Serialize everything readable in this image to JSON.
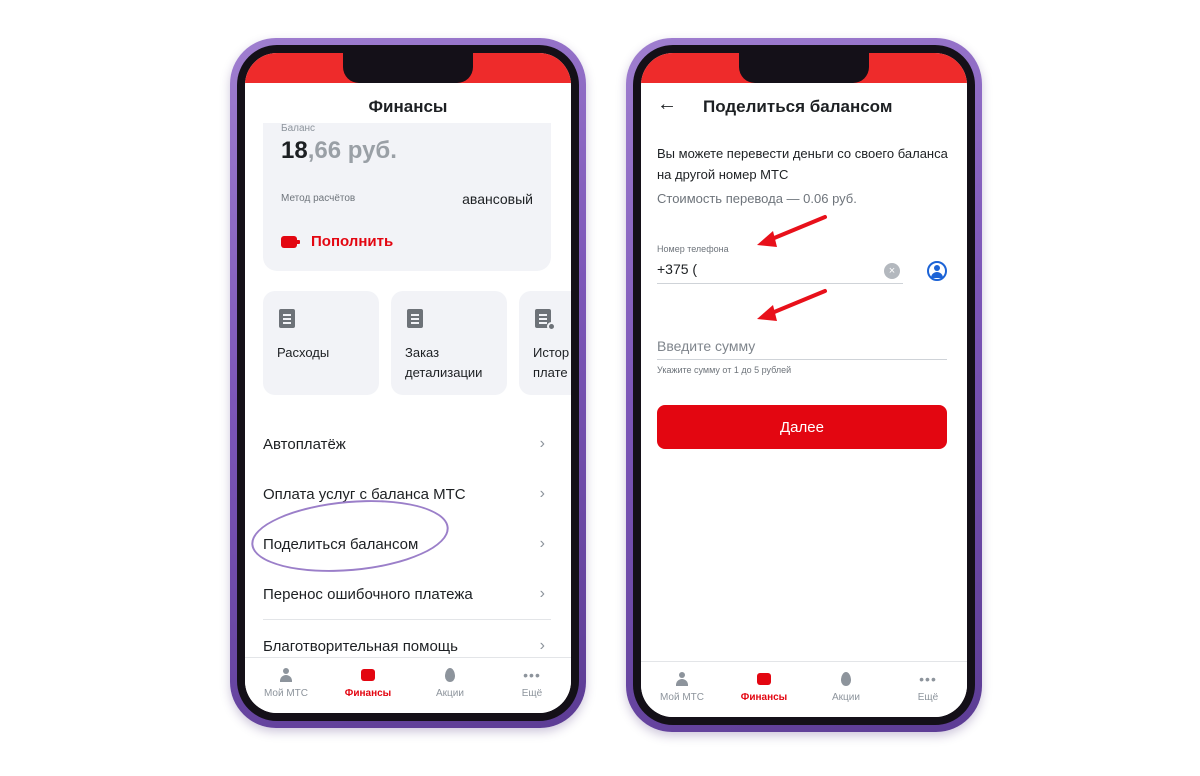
{
  "colors": {
    "brand_red": "#e30611",
    "status_bar_red": "#ee2b2b",
    "frame_purple": "#7c56b8",
    "annotation_purple": "#9b7fc9",
    "arrow_red": "#e8101a",
    "contact_blue": "#1c63d6"
  },
  "left": {
    "title": "Финансы",
    "balance": {
      "label": "Баланс",
      "amount_int": "18",
      "amount_frac": ",66 руб.",
      "method_label": "Метод расчётов",
      "method_value": "авансовый",
      "topup_icon": "wallet-icon",
      "topup_label": "Пополнить"
    },
    "tiles": [
      {
        "icon": "document-icon",
        "label_1": "Расходы",
        "label_2": ""
      },
      {
        "icon": "document-edit-icon",
        "label_1": "Заказ",
        "label_2": "детализации"
      },
      {
        "icon": "document-clock-icon",
        "label_1": "Истор",
        "label_2": "плате"
      }
    ],
    "menu": [
      "Автоплатёж",
      "Оплата услуг с баланса МТС",
      "Поделиться балансом",
      "Перенос ошибочного платежа",
      "Благотворительная помощь"
    ],
    "chevron": "›"
  },
  "right": {
    "title": "Поделиться балансом",
    "back_icon": "←",
    "description": "Вы можете перевести деньги со своего баланса на другой номер МТС",
    "cost": "Стоимость перевода — 0.06 руб.",
    "phone_label": "Номер телефона",
    "phone_value": "+375 (",
    "clear_icon": "×",
    "amount_placeholder": "Введите сумму",
    "amount_value": "",
    "amount_hint": "Укажите сумму от 1 до 5 рублей",
    "next_button": "Далее"
  },
  "tabbar": {
    "tabs": [
      {
        "label": "Мой МТС",
        "icon": "person-icon",
        "active": false
      },
      {
        "label": "Финансы",
        "icon": "wallet-icon",
        "active": true
      },
      {
        "label": "Акции",
        "icon": "flame-icon",
        "active": false
      },
      {
        "label": "Ещё",
        "icon": "more-dots-icon",
        "active": false
      }
    ],
    "dots": "•••"
  }
}
